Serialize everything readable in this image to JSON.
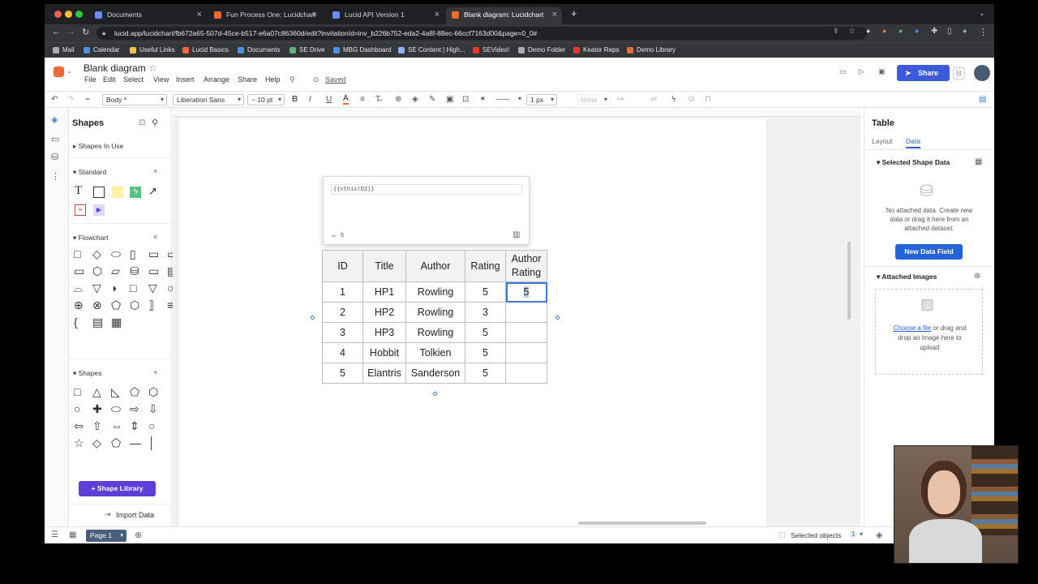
{
  "browser": {
    "tabs": [
      {
        "label": "Documents",
        "active": false
      },
      {
        "label": "Fun Process One: Lucidchart",
        "active": false
      },
      {
        "label": "Lucid API Version 1",
        "active": false
      },
      {
        "label": "Blank diagram: Lucidchart",
        "active": true
      }
    ],
    "url": "lucid.app/lucidchart/fb672a65-507d-45ce-b517-e6a07c86360d/edit?invitationId=inv_b226b752-eda2-4a8f-88ec-66ccf7163d00&page=0_0#",
    "bookmarks": [
      "Mail",
      "Calendar",
      "Useful Links",
      "Lucid Basics",
      "Documents",
      "SE Drive",
      "MBG Dashboard",
      "SE Content | High...",
      "SEVideo!",
      "Demo Folder",
      "Keator Reps",
      "Demo Library"
    ]
  },
  "app": {
    "doc_title": "Blank diagram",
    "menus": [
      "File",
      "Edit",
      "Select",
      "View",
      "Insert",
      "Arrange",
      "Share",
      "Help"
    ],
    "saved_label": "Saved",
    "share_label": "Share"
  },
  "toolbar": {
    "style": "Body *",
    "font": "Liberation Sans",
    "font_size": "10 pt",
    "line_width": "1 px",
    "arrow_none": "None"
  },
  "left_panel": {
    "title": "Shapes",
    "shapes_in_use": "Shapes In Use",
    "standard": "Standard",
    "flowchart": "Flowchart",
    "shapes": "Shapes",
    "shape_library_label": "Shape Library",
    "import_data_label": "Import Data"
  },
  "popup": {
    "formula": "{{=this!D2}}",
    "result": "5"
  },
  "table": {
    "headers": [
      "ID",
      "Title",
      "Author",
      "Rating",
      "Author\nRating"
    ],
    "rows": [
      [
        "1",
        "HP1",
        "Rowling",
        "5",
        "5"
      ],
      [
        "2",
        "HP2",
        "Rowling",
        "3",
        ""
      ],
      [
        "3",
        "HP3",
        "Rowling",
        "5",
        ""
      ],
      [
        "4",
        "Hobbit",
        "Tolkien",
        "5",
        ""
      ],
      [
        "5",
        "Elantris",
        "Sanderson",
        "5",
        ""
      ]
    ]
  },
  "right_panel": {
    "title": "Table",
    "tabs": [
      "Layout",
      "Data"
    ],
    "active_tab": "Data",
    "selected_shape_data": "Selected Shape Data",
    "no_data_text": "No attached data. Create new data or drag it here from an attached dataset.",
    "new_field_label": "New Data Field",
    "attached_images": "Attached Images",
    "choose_file": "Choose a file",
    "drop_text": "or drag and drop an image here to upload"
  },
  "bottom": {
    "page_label": "Page 1",
    "selected_objects": "Selected objects",
    "selected_count": "1"
  },
  "colors": {
    "share": "#3b5bdb",
    "shape_library": "#5b3fd6",
    "new_field": "#2563d9",
    "selection": "#3a7bd5"
  }
}
